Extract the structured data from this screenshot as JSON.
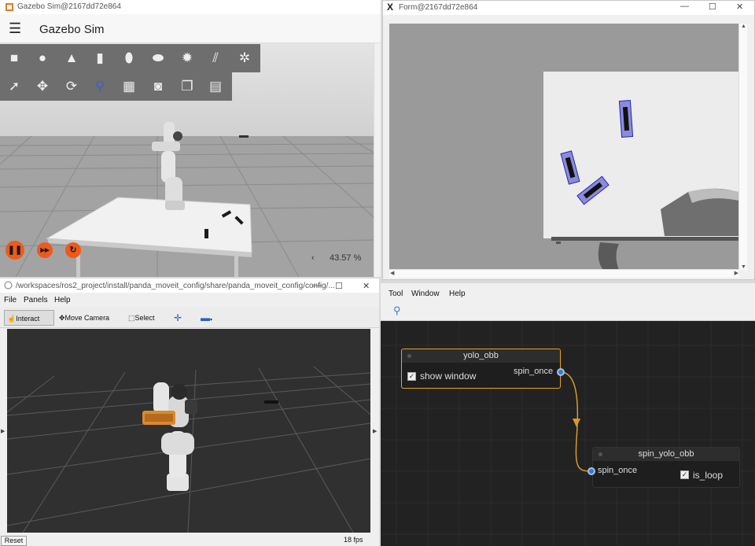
{
  "gazebo": {
    "window_title": "Gazebo Sim@2167dd72e864",
    "app_title": "Gazebo Sim",
    "real_time_factor": "43.57 %",
    "rtf_arrow": "‹"
  },
  "form": {
    "window_title": "Form@2167dd72e864",
    "logo": "X"
  },
  "rviz": {
    "window_title": "/workspaces/ros2_project/install/panda_moveit_config/share/panda_moveit_config/config/...",
    "menu": [
      "File",
      "Panels",
      "Help"
    ],
    "tools": {
      "interact": "Interact",
      "move_camera": "Move Camera",
      "select": "Select"
    },
    "reset_label": "Reset",
    "fps": "18 fps"
  },
  "nodes": {
    "menu": [
      "Tool",
      "Window",
      "Help"
    ],
    "yolo": {
      "title": "yolo_obb",
      "option_label": "show window",
      "option_checked": true,
      "output_port": "spin_once"
    },
    "spin": {
      "title": "spin_yolo_obb",
      "input_port": "spin_once",
      "option_label": "is_loop",
      "option_checked": true
    },
    "colors": {
      "selected_border": "#e6a428",
      "port": "#3c78c8",
      "connection": "#d69a2c"
    }
  }
}
